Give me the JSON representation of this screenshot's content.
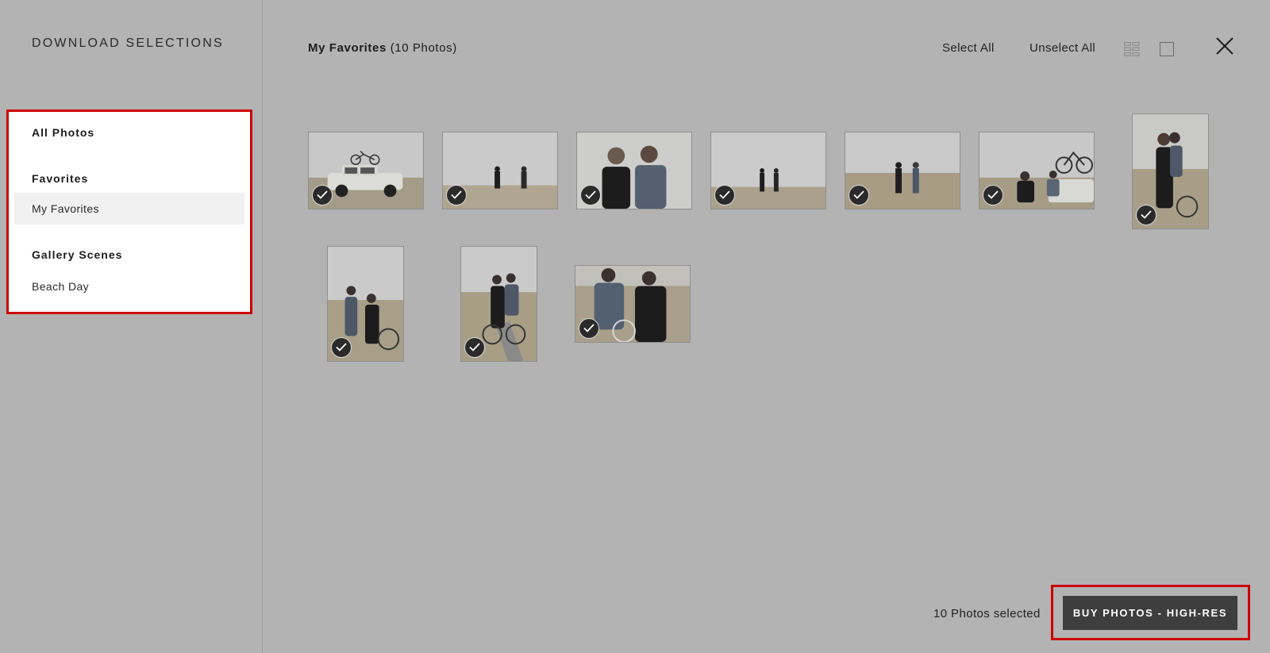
{
  "sidebar": {
    "title": "DOWNLOAD SELECTIONS",
    "all_photos": "All Photos",
    "favorites_heading": "Favorites",
    "favorites_item": "My Favorites",
    "scenes_heading": "Gallery Scenes",
    "scenes_item": "Beach Day"
  },
  "header": {
    "collection": "My Favorites",
    "count": "(10 Photos)",
    "select_all": "Select All",
    "unselect_all": "Unselect All",
    "view_icons": [
      "grid-view-icon",
      "single-view-icon"
    ],
    "close_icon": "close-icon"
  },
  "photos": [
    {
      "subject": "car-with-bicycle",
      "selected": true
    },
    {
      "subject": "two-people-running-beach",
      "selected": true
    },
    {
      "subject": "couple-portrait",
      "selected": true
    },
    {
      "subject": "two-people-standing-beach",
      "selected": true
    },
    {
      "subject": "couple-walking-dunes",
      "selected": true
    },
    {
      "subject": "couple-with-bike-on-car",
      "selected": true
    },
    {
      "subject": "woman-with-bicycle",
      "selected": true
    },
    {
      "subject": "couple-with-bicycle",
      "selected": true
    },
    {
      "subject": "couple-riding-bicycle",
      "selected": true
    },
    {
      "subject": "couple-with-bicycle-closeup",
      "selected": true
    }
  ],
  "footer": {
    "selected_text": "10 Photos selected",
    "buy_button": "BUY PHOTOS - HIGH-RES"
  },
  "colors": {
    "overlay": "#b3b3b3",
    "highlight_border": "#cc0000",
    "button": "#3e3e3e"
  }
}
